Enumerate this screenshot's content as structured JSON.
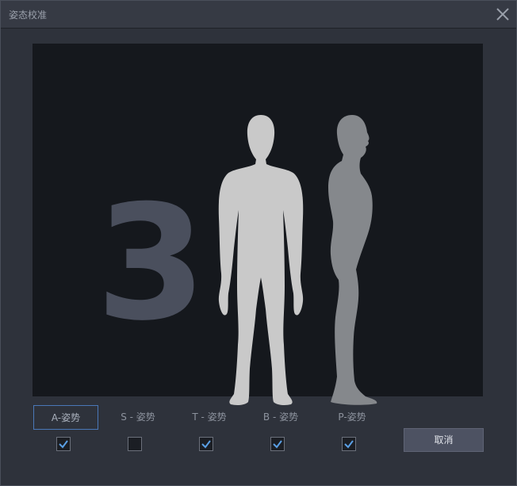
{
  "window": {
    "title": "姿态校准"
  },
  "preview": {
    "countdown": "3"
  },
  "poses": [
    {
      "label": "A-姿势",
      "checked": true,
      "selected": true
    },
    {
      "label": "S - 姿势",
      "checked": false,
      "selected": false
    },
    {
      "label": "T - 姿势",
      "checked": true,
      "selected": false
    },
    {
      "label": "B - 姿势",
      "checked": true,
      "selected": false
    },
    {
      "label": "P-姿势",
      "checked": true,
      "selected": false
    }
  ],
  "actions": {
    "cancel_label": "取消"
  },
  "icons": {
    "close": "close-icon",
    "check": "checkmark-icon"
  },
  "colors": {
    "accent": "#4a78b8",
    "check": "#5aa0e6"
  }
}
